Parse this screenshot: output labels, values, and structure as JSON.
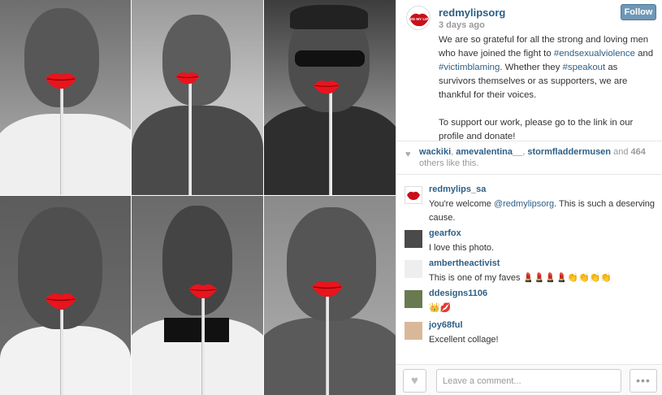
{
  "post": {
    "username": "redmylipsorg",
    "time_ago": "3 days ago",
    "follow_label": "Follow",
    "caption_parts": {
      "p1_a": "We are so grateful for all the strong and loving men who have joined the fight to ",
      "tag1": "#endsexualviolence",
      "p1_b": " and ",
      "tag2": "#victimblaming",
      "p1_c": ". Whether they ",
      "tag3": "#speakout",
      "p1_d": " as survivors themselves or as supporters, we are thankful for their voices.",
      "p2": "To support our work, please go to the link in our profile and donate!"
    },
    "avatar_text": "RED MY LIPS"
  },
  "likes": {
    "user1": "wackiki",
    "user2": "amevalentina__",
    "user3": "stormfladdermusen",
    "and_text": " and ",
    "count": "464",
    "suffix": " others like this.",
    "sep": ", "
  },
  "comments": [
    {
      "user": "redmylips_sa",
      "text_a": "You're welcome ",
      "mention": "@redmylipsorg",
      "text_b": ". This is such a deserving cause."
    },
    {
      "user": "gearfox",
      "text": "I love this photo."
    },
    {
      "user": "ambertheactivist",
      "text": "This is one of my faves 💄💄💄💄👏👏👏👏"
    },
    {
      "user": "ddesigns1106",
      "text": "👑💋"
    },
    {
      "user": "joy68ful",
      "text": "Excellent collage!"
    }
  ],
  "composer": {
    "placeholder": "Leave a comment...",
    "more_label": "•••"
  },
  "icons": {
    "like": "heart-icon",
    "more": "ellipsis-icon",
    "likes_heart": "heart-icon"
  },
  "colors": {
    "link": "#2d5f86",
    "follow_bg": "#6f97b6",
    "lips": "#e8141e"
  }
}
